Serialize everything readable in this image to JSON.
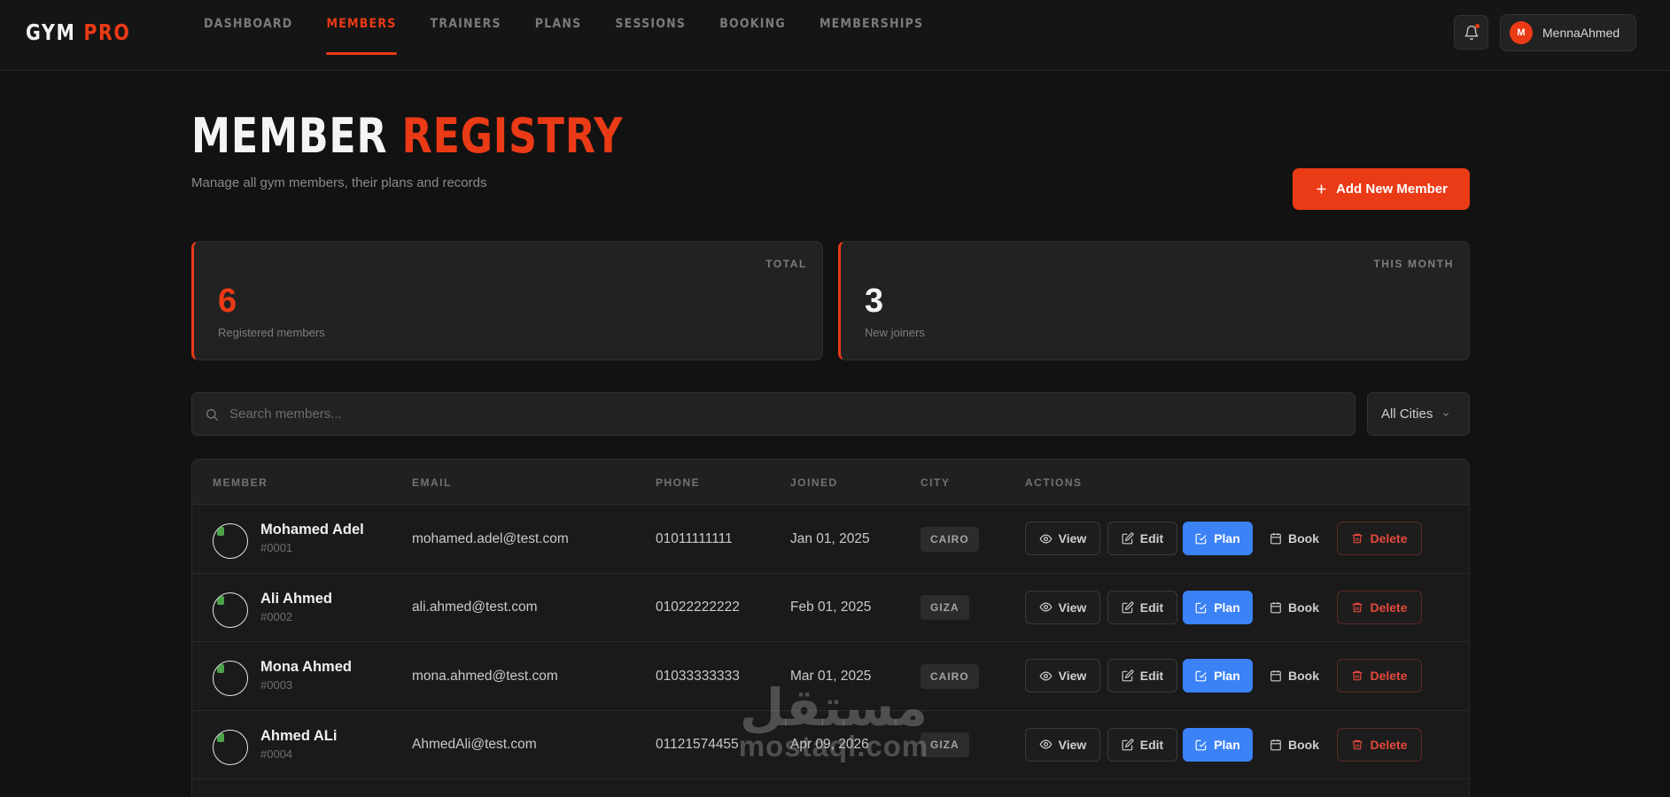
{
  "app": {
    "logo_part1": "GYM",
    "logo_part2": "PRO"
  },
  "nav": [
    {
      "label": "DASHBOARD",
      "active": false
    },
    {
      "label": "MEMBERS",
      "active": true
    },
    {
      "label": "TRAINERS",
      "active": false
    },
    {
      "label": "PLANS",
      "active": false
    },
    {
      "label": "SESSIONS",
      "active": false
    },
    {
      "label": "BOOKING",
      "active": false
    },
    {
      "label": "MEMBERSHIPS",
      "active": false
    }
  ],
  "user": {
    "initial": "M",
    "name": "MennaAhmed"
  },
  "header": {
    "title_part1": "MEMBER",
    "title_part2": "REGISTRY",
    "subtitle": "Manage all gym members, their plans and records",
    "add_button": "Add New Member"
  },
  "stats": [
    {
      "label": "TOTAL",
      "value": "6",
      "desc": "Registered members",
      "color": "#ea3a16"
    },
    {
      "label": "THIS MONTH",
      "value": "3",
      "desc": "New joiners",
      "color": "#f4f4f4"
    }
  ],
  "search": {
    "placeholder": "Search members..."
  },
  "city_filter": {
    "selected": "All Cities"
  },
  "table": {
    "columns": [
      "MEMBER",
      "EMAIL",
      "PHONE",
      "JOINED",
      "CITY",
      "ACTIONS"
    ],
    "actions": {
      "view": "View",
      "edit": "Edit",
      "plan": "Plan",
      "book": "Book",
      "delete": "Delete"
    },
    "rows": [
      {
        "name": "Mohamed Adel",
        "id": "#0001",
        "email": "mohamed.adel@test.com",
        "phone": "01011111111",
        "joined": "Jan 01, 2025",
        "city": "CAIRO"
      },
      {
        "name": "Ali Ahmed",
        "id": "#0002",
        "email": "ali.ahmed@test.com",
        "phone": "01022222222",
        "joined": "Feb 01, 2025",
        "city": "GIZA"
      },
      {
        "name": "Mona Ahmed",
        "id": "#0003",
        "email": "mona.ahmed@test.com",
        "phone": "01033333333",
        "joined": "Mar 01, 2025",
        "city": "CAIRO"
      },
      {
        "name": "Ahmed ALi",
        "id": "#0004",
        "email": "AhmedAli@test.com",
        "phone": "01121574455",
        "joined": "Apr 09, 2026",
        "city": "GIZA"
      }
    ]
  },
  "watermark": {
    "arabic": "مستقل",
    "latin": "mostaql.com"
  }
}
